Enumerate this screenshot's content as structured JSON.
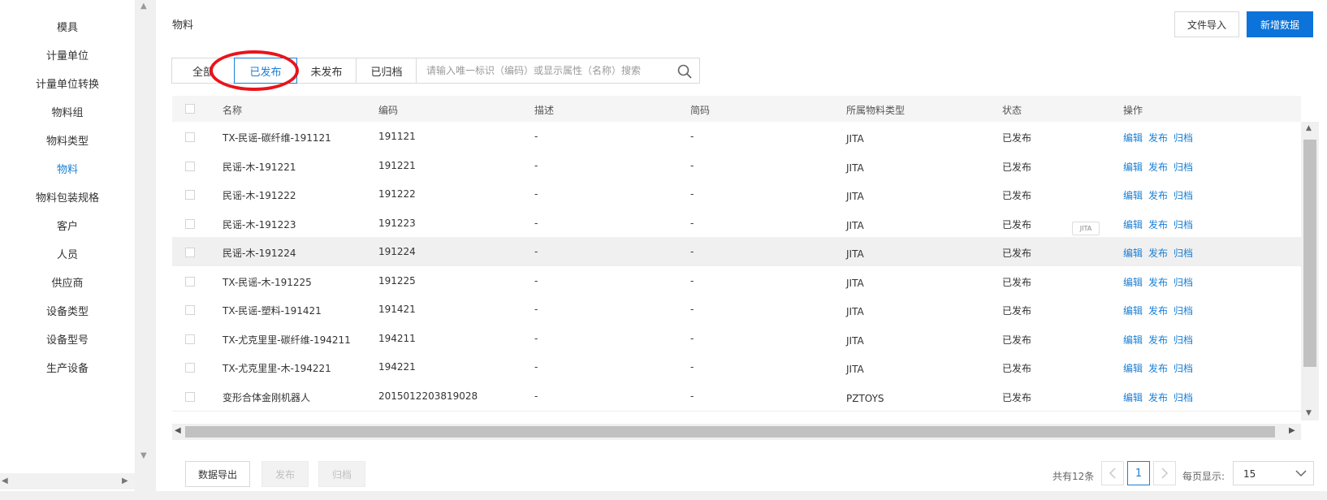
{
  "sidebar": {
    "items": [
      {
        "label": "模具"
      },
      {
        "label": "计量单位"
      },
      {
        "label": "计量单位转换"
      },
      {
        "label": "物料组"
      },
      {
        "label": "物料类型"
      },
      {
        "label": "物料",
        "active": true
      },
      {
        "label": "物料包装规格"
      },
      {
        "label": "客户"
      },
      {
        "label": "人员"
      },
      {
        "label": "供应商"
      },
      {
        "label": "设备类型"
      },
      {
        "label": "设备型号"
      },
      {
        "label": "生产设备"
      }
    ]
  },
  "header": {
    "title": "物料",
    "import_label": "文件导入",
    "add_label": "新增数据"
  },
  "tabs": [
    {
      "label": "全部"
    },
    {
      "label": "已发布",
      "active": true
    },
    {
      "label": "未发布"
    },
    {
      "label": "已归档"
    }
  ],
  "search": {
    "placeholder": "请输入唯一标识（编码）或显示属性（名称）搜索",
    "icon": "search-icon"
  },
  "table": {
    "columns": [
      "名称",
      "编码",
      "描述",
      "简码",
      "所属物料类型",
      "状态",
      "操作"
    ],
    "rows": [
      {
        "name": "TX-民谣-碳纤维-191121",
        "code": "191121",
        "desc": "-",
        "short": "-",
        "type": "JITA",
        "status": "已发布"
      },
      {
        "name": "民谣-木-191221",
        "code": "191221",
        "desc": "-",
        "short": "-",
        "type": "JITA",
        "status": "已发布"
      },
      {
        "name": "民谣-木-191222",
        "code": "191222",
        "desc": "-",
        "short": "-",
        "type": "JITA",
        "status": "已发布"
      },
      {
        "name": "民谣-木-191223",
        "code": "191223",
        "desc": "-",
        "short": "-",
        "type": "JITA",
        "status": "已发布"
      },
      {
        "name": "民谣-木-191224",
        "code": "191224",
        "desc": "-",
        "short": "-",
        "type": "JITA",
        "status": "已发布",
        "hover": true
      },
      {
        "name": "TX-民谣-木-191225",
        "code": "191225",
        "desc": "-",
        "short": "-",
        "type": "JITA",
        "status": "已发布"
      },
      {
        "name": "TX-民谣-塑料-191421",
        "code": "191421",
        "desc": "-",
        "short": "-",
        "type": "JITA",
        "status": "已发布"
      },
      {
        "name": "TX-尤克里里-碳纤维-194211",
        "code": "194211",
        "desc": "-",
        "short": "-",
        "type": "JITA",
        "status": "已发布"
      },
      {
        "name": "TX-尤克里里-木-194221",
        "code": "194221",
        "desc": "-",
        "short": "-",
        "type": "JITA",
        "status": "已发布"
      },
      {
        "name": "变形合体金刚机器人",
        "code": "2015012203819028",
        "desc": "-",
        "short": "-",
        "type": "PZTOYS",
        "status": "已发布"
      }
    ],
    "actions": {
      "edit": "编辑",
      "publish": "发布",
      "archive": "归档"
    },
    "tooltip": "JITA"
  },
  "footer": {
    "export_label": "数据导出",
    "publish_label": "发布",
    "archive_label": "归档",
    "total_text": "共有12条",
    "current_page": "1",
    "per_page_label": "每页显示:",
    "per_page_value": "15"
  },
  "colors": {
    "accent": "#1a7fd4",
    "primary_button": "#0b73d9",
    "highlight_ring": "#e8141c"
  }
}
